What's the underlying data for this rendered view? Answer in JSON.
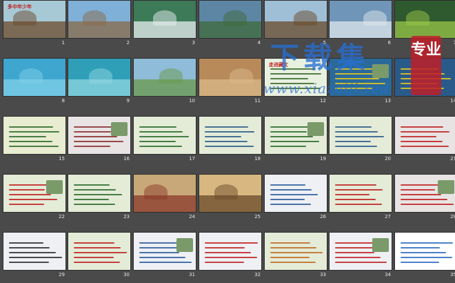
{
  "slides": [
    {
      "num": "1",
      "bg": "#a7c9d6",
      "title": "多中年少年",
      "title_color": "#c02020",
      "kind": "photo",
      "accent": "#6b4a2b"
    },
    {
      "num": "2",
      "bg": "#7fb0d8",
      "title": "",
      "kind": "photo",
      "accent": "#8a6a48"
    },
    {
      "num": "3",
      "bg": "#3d7a58",
      "title": "",
      "kind": "photo",
      "accent": "#e8eef0"
    },
    {
      "num": "4",
      "bg": "#5c86a4",
      "title": "",
      "kind": "photo",
      "accent": "#3f6a3a"
    },
    {
      "num": "5",
      "bg": "#9fbfd6",
      "title": "",
      "kind": "photo",
      "accent": "#6a4a2a"
    },
    {
      "num": "6",
      "bg": "#6f95b8",
      "title": "",
      "kind": "photo",
      "accent": "#dfe7ec"
    },
    {
      "num": "7",
      "bg": "#2f5a2f",
      "title": "",
      "kind": "photo",
      "accent": "#9ac64a"
    },
    {
      "num": "8",
      "bg": "#3fa6cf",
      "title": "",
      "kind": "photo",
      "accent": "#7fd0e8"
    },
    {
      "num": "9",
      "bg": "#2f9fb8",
      "title": "",
      "kind": "photo",
      "accent": "#8fd6e0"
    },
    {
      "num": "10",
      "bg": "#8fbcd9",
      "title": "",
      "kind": "photo",
      "accent": "#6a9a4a"
    },
    {
      "num": "11",
      "bg": "#b88a5a",
      "title": "",
      "kind": "photo",
      "accent": "#d9b88a"
    },
    {
      "num": "12",
      "bg": "#e8f0e0",
      "title": "走进藏文",
      "title_color": "#c02020",
      "kind": "text",
      "accent": "#3a6a2a"
    },
    {
      "num": "13",
      "bg": "#2a6a9a",
      "title": "",
      "kind": "text",
      "accent": "#e8c820"
    },
    {
      "num": "14",
      "bg": "#2a5a8a",
      "title": "",
      "kind": "text",
      "accent": "#e8c820"
    },
    {
      "num": "15",
      "bg": "#e8ecd0",
      "title": "",
      "kind": "text",
      "accent": "#2a6a2a"
    },
    {
      "num": "16",
      "bg": "#e8e4e4",
      "title": "",
      "kind": "text",
      "accent": "#8a2a2a"
    },
    {
      "num": "17",
      "bg": "#e4ecd8",
      "title": "",
      "kind": "text",
      "accent": "#2a6a2a"
    },
    {
      "num": "18",
      "bg": "#e4ecd8",
      "title": "",
      "kind": "text",
      "accent": "#2a5a8a"
    },
    {
      "num": "19",
      "bg": "#e4ecd8",
      "title": "",
      "kind": "text",
      "accent": "#2a6a2a"
    },
    {
      "num": "20",
      "bg": "#e4ecd8",
      "title": "",
      "kind": "text",
      "accent": "#2a5a8a"
    },
    {
      "num": "21",
      "bg": "#e8e4e4",
      "title": "",
      "kind": "text",
      "accent": "#c02020"
    },
    {
      "num": "22",
      "bg": "#e4ecd8",
      "title": "",
      "kind": "text",
      "accent": "#c02020"
    },
    {
      "num": "23",
      "bg": "#e4ecd8",
      "title": "",
      "kind": "text",
      "accent": "#2a6a2a"
    },
    {
      "num": "24",
      "bg": "#c8a878",
      "title": "",
      "kind": "photo",
      "accent": "#8a3a2a"
    },
    {
      "num": "25",
      "bg": "#d8b880",
      "title": "",
      "kind": "photo",
      "accent": "#6a4a2a"
    },
    {
      "num": "26",
      "bg": "#eef0f4",
      "title": "",
      "kind": "text",
      "accent": "#2a5a9a"
    },
    {
      "num": "27",
      "bg": "#e4ecd8",
      "title": "",
      "kind": "text",
      "accent": "#c02020"
    },
    {
      "num": "28",
      "bg": "#e8e4e4",
      "title": "",
      "kind": "text",
      "accent": "#c02020"
    },
    {
      "num": "29",
      "bg": "#eef0f4",
      "title": "",
      "kind": "text",
      "accent": "#2a2a2a"
    },
    {
      "num": "30",
      "bg": "#e4ecd8",
      "title": "",
      "kind": "text",
      "accent": "#c02020"
    },
    {
      "num": "31",
      "bg": "#eef0f4",
      "title": "",
      "kind": "text",
      "accent": "#2a5a9a"
    },
    {
      "num": "32",
      "bg": "#eef0f4",
      "title": "",
      "kind": "text",
      "accent": "#c02020"
    },
    {
      "num": "33",
      "bg": "#e4ecd8",
      "title": "",
      "kind": "text",
      "accent": "#c06a20"
    },
    {
      "num": "34",
      "bg": "#eef0f4",
      "title": "",
      "kind": "text",
      "accent": "#c02020"
    },
    {
      "num": "35",
      "bg": "#ffffff",
      "title": "",
      "kind": "text",
      "accent": "#2a6ac0"
    }
  ],
  "watermark": {
    "cn": "下载集",
    "url": "www.xiazaiji.red",
    "seal": "专业"
  }
}
